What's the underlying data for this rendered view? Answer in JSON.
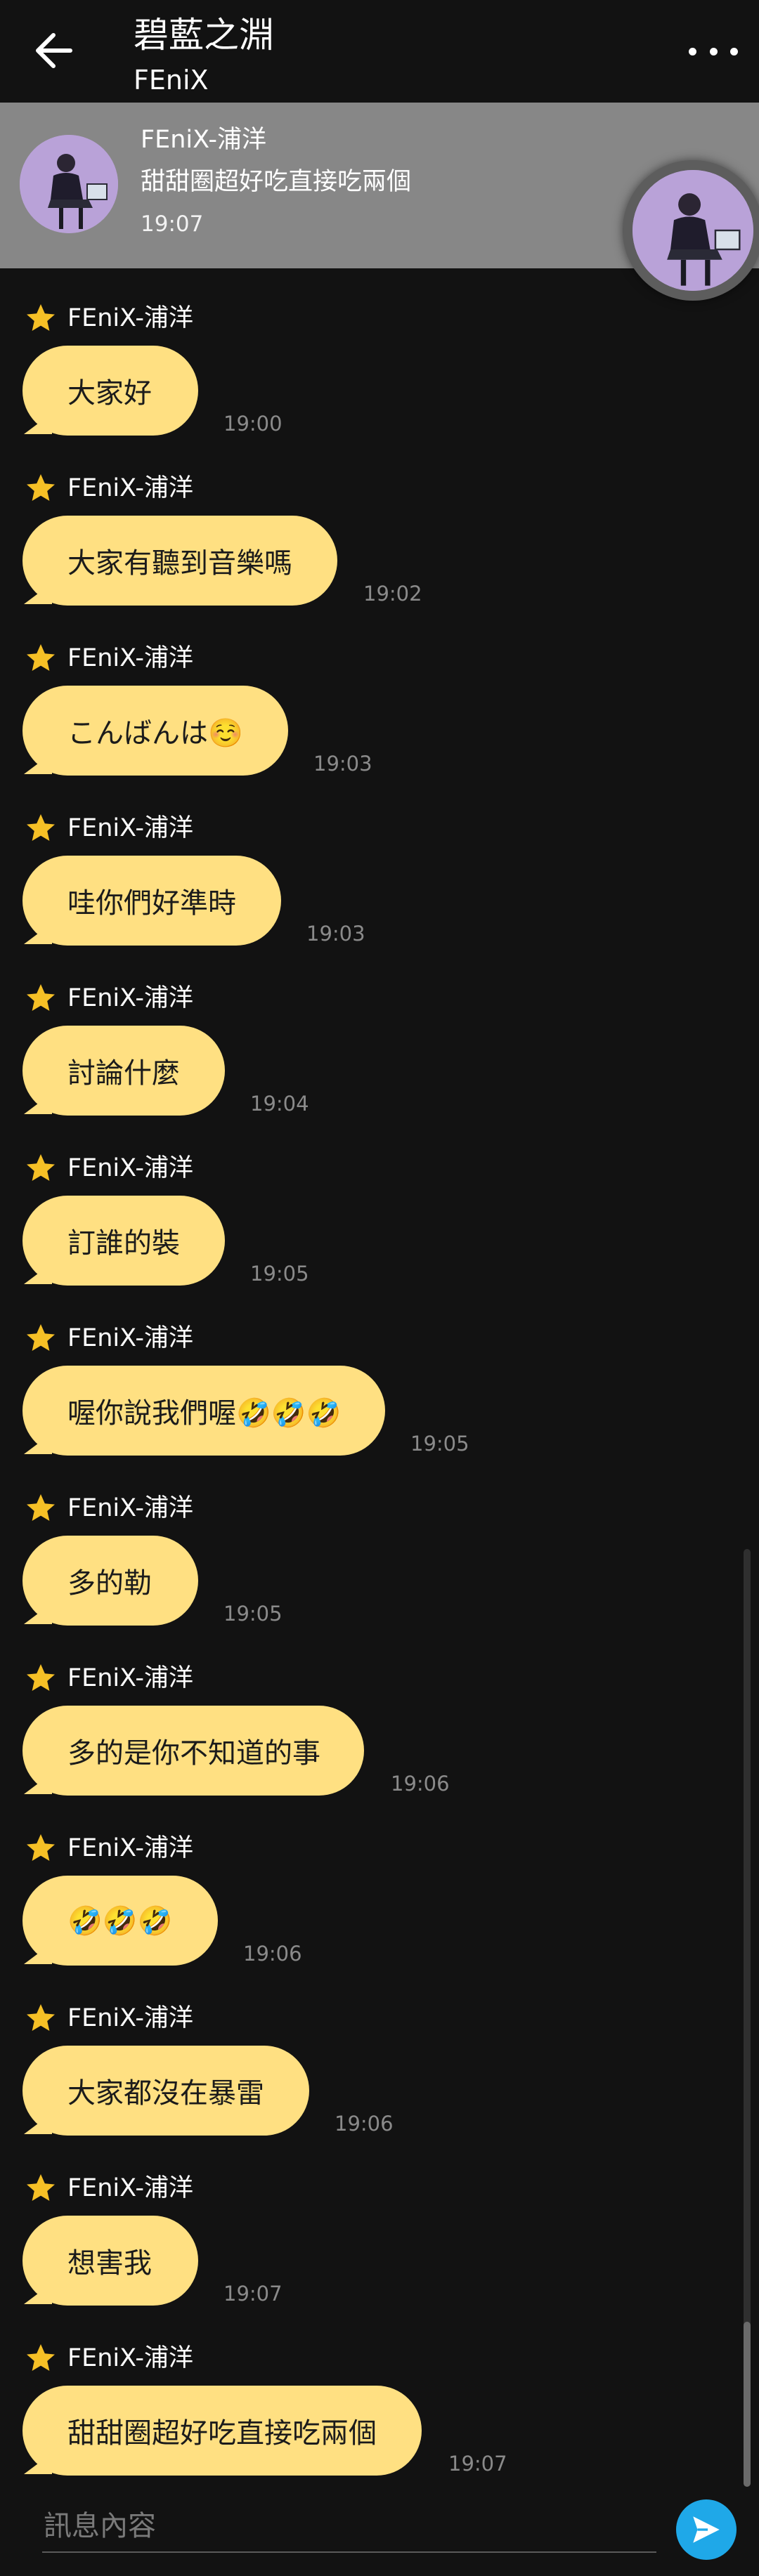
{
  "header": {
    "title": "碧藍之淵",
    "subtitle": "FEniX"
  },
  "pinned": {
    "sender": "FEniX-浦洋",
    "text": "甜甜圈超好吃直接吃兩個",
    "time": "19:07"
  },
  "messages": [
    {
      "sender": "FEniX-浦洋",
      "text": "大家好",
      "time": "19:00"
    },
    {
      "sender": "FEniX-浦洋",
      "text": "大家有聽到音樂嗎",
      "time": "19:02"
    },
    {
      "sender": "FEniX-浦洋",
      "text": "こんばんは☺️",
      "time": "19:03"
    },
    {
      "sender": "FEniX-浦洋",
      "text": "哇你們好準時",
      "time": "19:03"
    },
    {
      "sender": "FEniX-浦洋",
      "text": "討論什麼",
      "time": "19:04"
    },
    {
      "sender": "FEniX-浦洋",
      "text": "訂誰的裝",
      "time": "19:05"
    },
    {
      "sender": "FEniX-浦洋",
      "text": "喔你說我們喔🤣🤣🤣",
      "time": "19:05"
    },
    {
      "sender": "FEniX-浦洋",
      "text": "多的勒",
      "time": "19:05"
    },
    {
      "sender": "FEniX-浦洋",
      "text": "多的是你不知道的事",
      "time": "19:06"
    },
    {
      "sender": "FEniX-浦洋",
      "text": "🤣🤣🤣",
      "time": "19:06"
    },
    {
      "sender": "FEniX-浦洋",
      "text": "大家都沒在暴雷",
      "time": "19:06"
    },
    {
      "sender": "FEniX-浦洋",
      "text": "想害我",
      "time": "19:07"
    },
    {
      "sender": "FEniX-浦洋",
      "text": "甜甜圈超好吃直接吃兩個",
      "time": "19:07"
    }
  ],
  "composer": {
    "placeholder": "訊息內容"
  },
  "colors": {
    "background": "#121212",
    "bubble": "#ffe082",
    "pinned_bar": "#878787",
    "send_button": "#1fa8e8",
    "star": "#f6c026"
  },
  "icons": {
    "back": "arrow-left-icon",
    "more": "more-horizontal-icon",
    "star": "star-icon",
    "send": "send-icon"
  }
}
